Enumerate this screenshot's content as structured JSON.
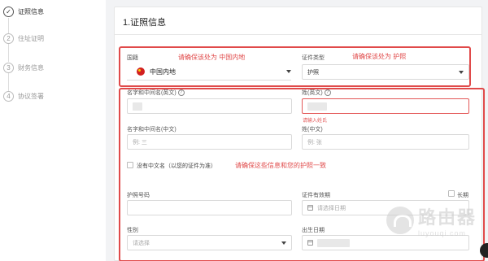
{
  "steps": [
    {
      "num": "✓",
      "label": "证照信息"
    },
    {
      "num": "2",
      "label": "住址证明"
    },
    {
      "num": "3",
      "label": "财务信息"
    },
    {
      "num": "4",
      "label": "协议签署"
    }
  ],
  "section_title": "1.证照信息",
  "country": {
    "label": "国籍",
    "value": "中国内地",
    "annotation": "请确保该处为 中国内地"
  },
  "id_type": {
    "label": "证件类型",
    "value": "护照",
    "annotation": "请确保该处为 护照"
  },
  "given_name_en": {
    "label": "名字和中间名(英文)",
    "help": "?"
  },
  "surname_en": {
    "label": "姓(英文)",
    "help": "?",
    "error": "请输入姓氏"
  },
  "given_name_cn": {
    "label": "名字和中间名(中文)",
    "placeholder": "例: 三"
  },
  "surname_cn": {
    "label": "姓(中文)",
    "placeholder": "例: 张"
  },
  "no_chinese_name": {
    "label": "没有中文名（以您的证件为准）"
  },
  "match_annotation": "请确保这些信息和您的护照一致",
  "passport_no": {
    "label": "护照号码"
  },
  "validity": {
    "label": "证件有效期",
    "placeholder": "请选择日期",
    "long_term": "长期"
  },
  "gender": {
    "label": "性别",
    "placeholder": "请选择"
  },
  "birthdate": {
    "label": "出生日期"
  },
  "watermark": {
    "cn": "路由器",
    "en": "luyouqi.com"
  },
  "colors": {
    "annotation": "#e04a4a",
    "error": "#e35757"
  }
}
